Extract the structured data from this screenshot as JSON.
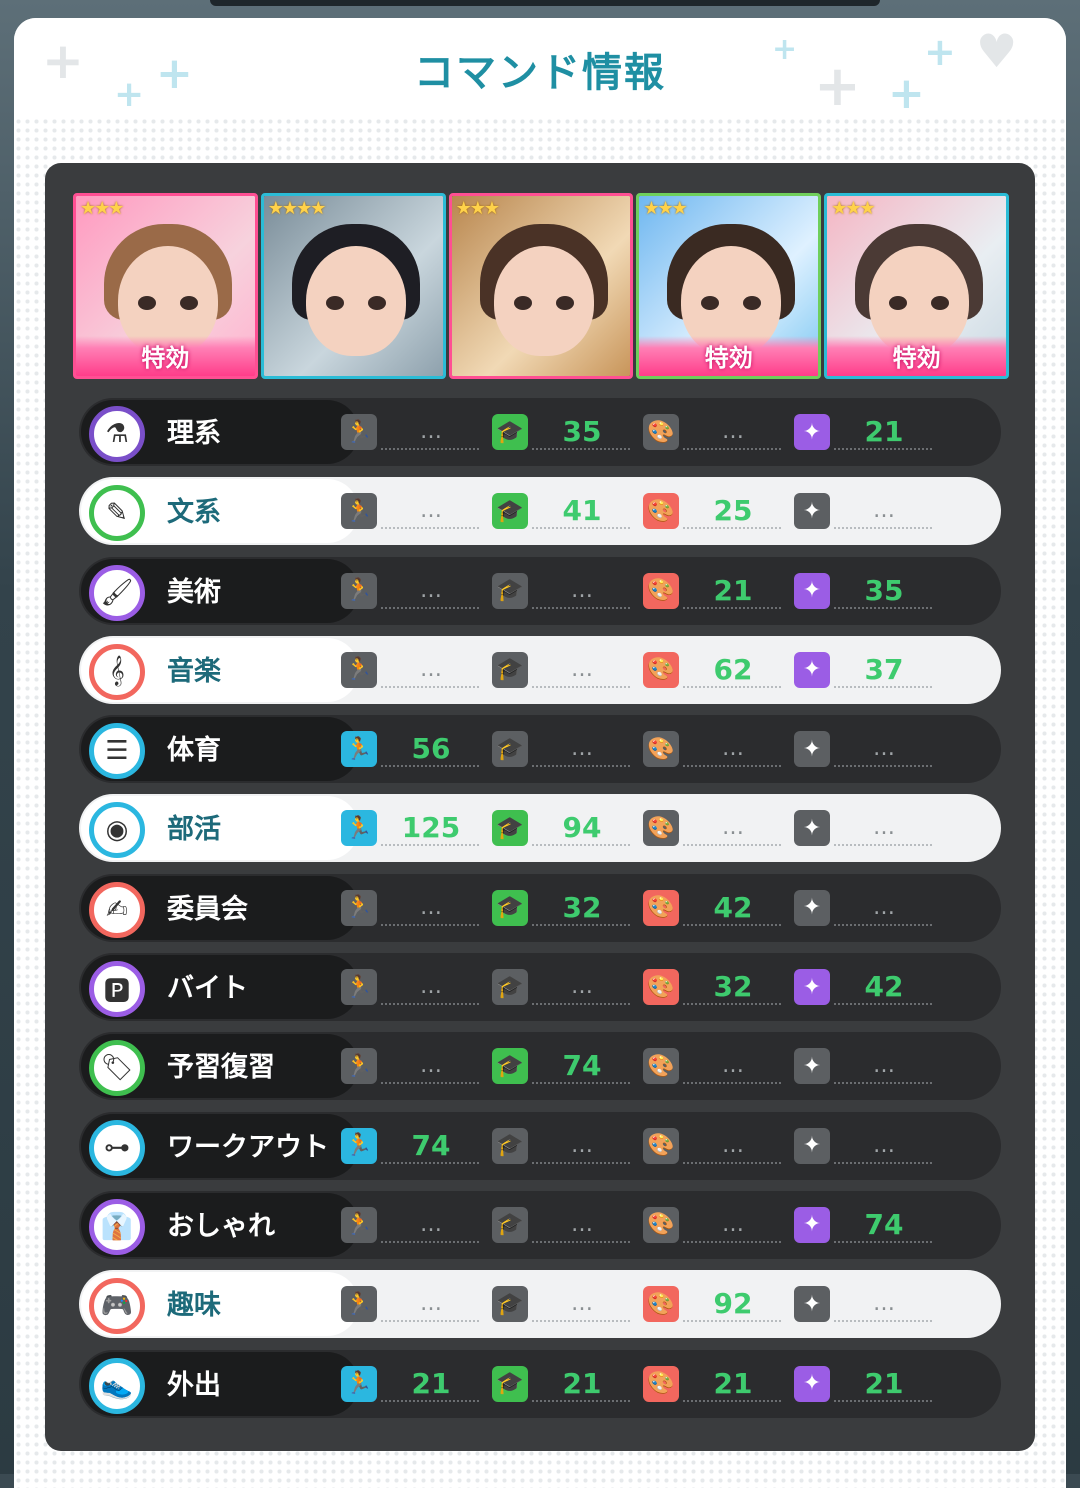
{
  "title": "コマンド情報",
  "colors": {
    "teal": "#1f8fa3",
    "stat_value": "#3ecb6e",
    "physical": "#2bb7e0",
    "study": "#3fbf4f",
    "art": "#f2675e",
    "special": "#9b5de5",
    "inactive": "#5c5f62"
  },
  "cards": [
    {
      "stars": "★★★",
      "rarity": 3,
      "border": "pink",
      "badge": "特効"
    },
    {
      "stars": "★★★★",
      "rarity": 4,
      "border": "blue",
      "badge": ""
    },
    {
      "stars": "★★★",
      "rarity": 3,
      "border": "pink",
      "badge": ""
    },
    {
      "stars": "★★★",
      "rarity": 3,
      "border": "green",
      "badge": "特効"
    },
    {
      "stars": "★★★",
      "rarity": 3,
      "border": "blue",
      "badge": "特効"
    }
  ],
  "stat_icons": [
    {
      "name": "running-icon",
      "glyph": "🏃",
      "color": "#2bb7e0"
    },
    {
      "name": "graduation-cap-icon",
      "glyph": "🎓",
      "color": "#3fbf4f"
    },
    {
      "name": "palette-icon",
      "glyph": "🎨",
      "color": "#f2675e"
    },
    {
      "name": "sparkle-icon",
      "glyph": "✦",
      "color": "#9b5de5"
    }
  ],
  "commands": [
    {
      "name": "理系",
      "icon": "flask-icon",
      "glyph": "⚗",
      "ring": "#7a4fc9",
      "light": false,
      "values": [
        "…",
        "35",
        "…",
        "21"
      ]
    },
    {
      "name": "文系",
      "icon": "pen-icon",
      "glyph": "✎",
      "ring": "#3fbf4f",
      "light": true,
      "values": [
        "…",
        "41",
        "25",
        "…"
      ]
    },
    {
      "name": "美術",
      "icon": "paint-tube-icon",
      "glyph": "🖌",
      "ring": "#9b5de5",
      "light": false,
      "values": [
        "…",
        "…",
        "21",
        "35"
      ]
    },
    {
      "name": "音楽",
      "icon": "treble-clef-icon",
      "glyph": "𝄞",
      "ring": "#f2675e",
      "light": true,
      "values": [
        "…",
        "…",
        "62",
        "37"
      ]
    },
    {
      "name": "体育",
      "icon": "vaulting-box-icon",
      "glyph": "☰",
      "ring": "#2bb7e0",
      "light": false,
      "values": [
        "56",
        "…",
        "…",
        "…"
      ]
    },
    {
      "name": "部活",
      "icon": "tennis-ball-icon",
      "glyph": "◉",
      "ring": "#2bb7e0",
      "light": true,
      "values": [
        "125",
        "94",
        "…",
        "…"
      ]
    },
    {
      "name": "委員会",
      "icon": "notepad-icon",
      "glyph": "✍",
      "ring": "#f2675e",
      "light": false,
      "values": [
        "…",
        "32",
        "42",
        "…"
      ]
    },
    {
      "name": "バイト",
      "icon": "sign-icon",
      "glyph": "🅿",
      "ring": "#9b5de5",
      "light": false,
      "values": [
        "…",
        "…",
        "32",
        "42"
      ]
    },
    {
      "name": "予習復習",
      "icon": "tag-icon",
      "glyph": "🏷",
      "ring": "#3fbf4f",
      "light": false,
      "values": [
        "…",
        "74",
        "…",
        "…"
      ]
    },
    {
      "name": "ワークアウト",
      "icon": "dumbbell-icon",
      "glyph": "⊶",
      "ring": "#2bb7e0",
      "light": false,
      "values": [
        "74",
        "…",
        "…",
        "…"
      ]
    },
    {
      "name": "おしゃれ",
      "icon": "jacket-icon",
      "glyph": "👔",
      "ring": "#9b5de5",
      "light": false,
      "values": [
        "…",
        "…",
        "…",
        "74"
      ]
    },
    {
      "name": "趣味",
      "icon": "gamepad-icon",
      "glyph": "🎮",
      "ring": "#f2675e",
      "light": true,
      "values": [
        "…",
        "…",
        "92",
        "…"
      ]
    },
    {
      "name": "外出",
      "icon": "sneaker-icon",
      "glyph": "👟",
      "ring": "#2bb7e0",
      "light": false,
      "values": [
        "21",
        "21",
        "21",
        "21"
      ]
    }
  ]
}
